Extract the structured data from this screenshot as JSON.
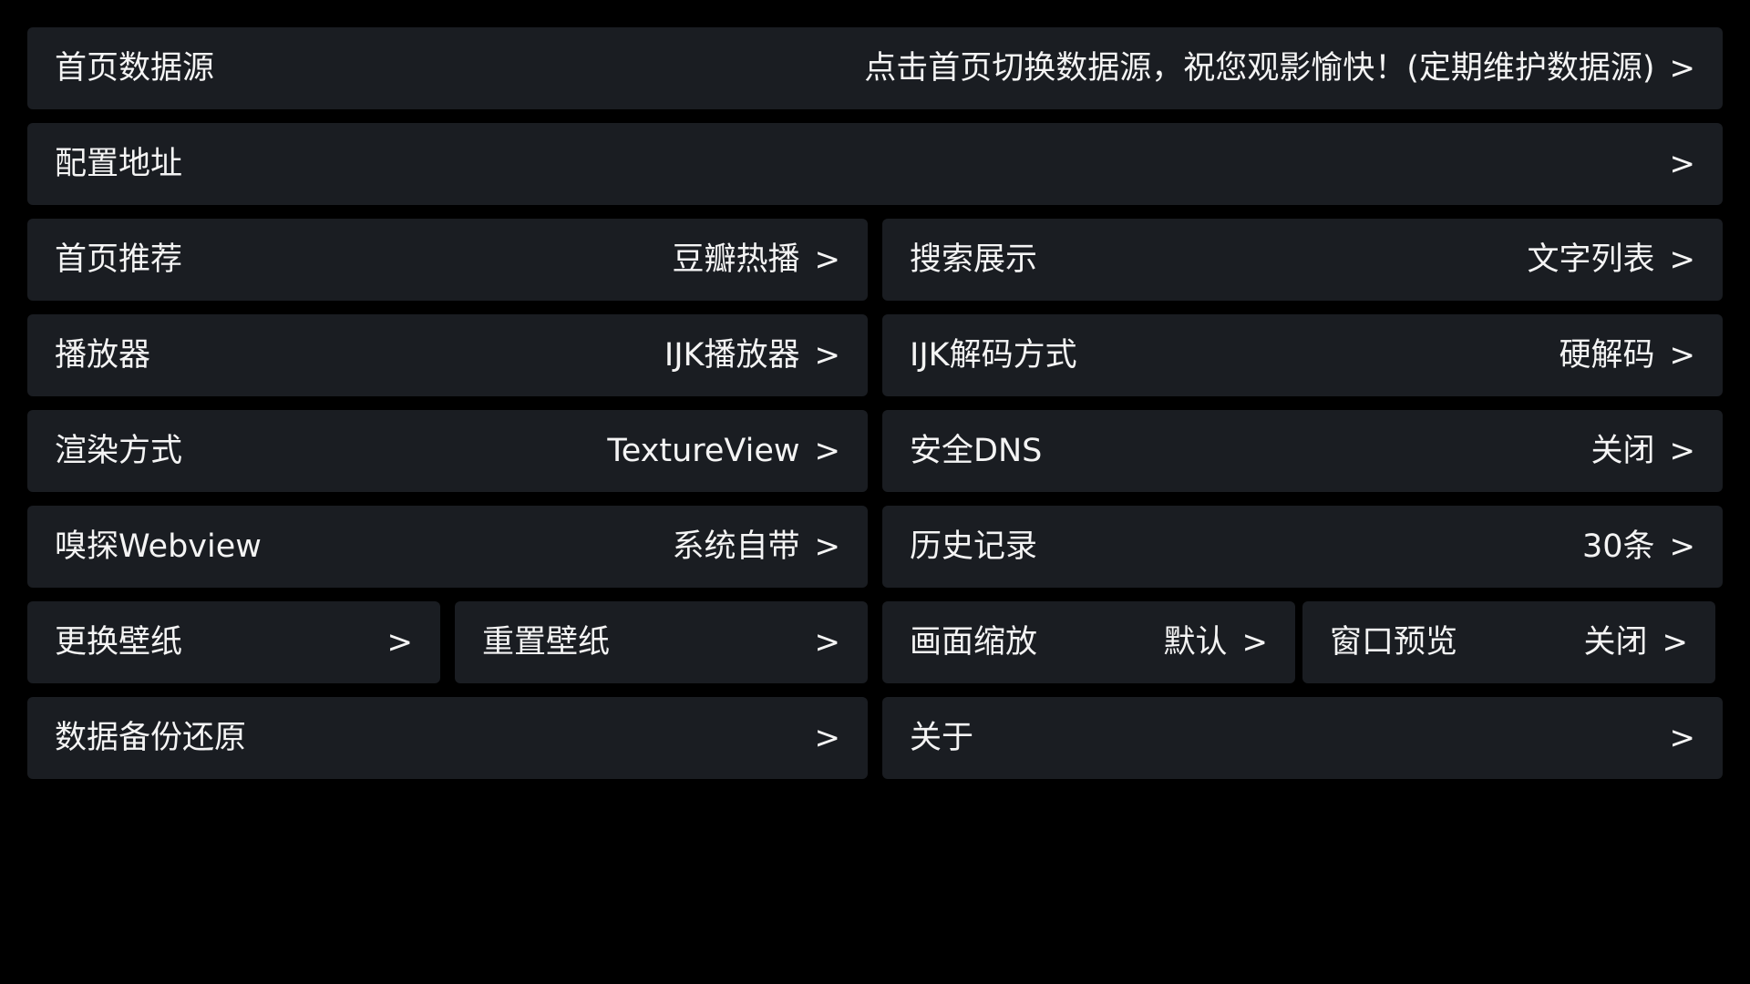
{
  "settings": {
    "home_source": {
      "label": "首页数据源",
      "value": "点击首页切换数据源，祝您观影愉快！(定期维护数据源)",
      "arrow": ">"
    },
    "config_address": {
      "label": "配置地址",
      "arrow": ">"
    },
    "home_recommend": {
      "label": "首页推荐",
      "value": "豆瓣热播",
      "arrow": ">"
    },
    "search_display": {
      "label": "搜索展示",
      "value": "文字列表",
      "arrow": ">"
    },
    "player": {
      "label": "播放器",
      "value": "IJK播放器",
      "arrow": ">"
    },
    "ijk_decode": {
      "label": "IJK解码方式",
      "value": "硬解码",
      "arrow": ">"
    },
    "render_mode": {
      "label": "渲染方式",
      "value": "TextureView",
      "arrow": ">"
    },
    "secure_dns": {
      "label": "安全DNS",
      "value": "关闭",
      "arrow": ">"
    },
    "sniff_webview": {
      "label": "嗅探Webview",
      "value": "系统自带",
      "arrow": ">"
    },
    "history": {
      "label": "历史记录",
      "value": "30条",
      "arrow": ">"
    },
    "change_wallpaper": {
      "label": "更换壁纸",
      "arrow": ">"
    },
    "reset_wallpaper": {
      "label": "重置壁纸",
      "arrow": ">"
    },
    "screen_scale": {
      "label": "画面缩放",
      "value": "默认",
      "arrow": ">"
    },
    "window_preview": {
      "label": "窗口预览",
      "value": "关闭",
      "arrow": ">"
    },
    "backup_restore": {
      "label": "数据备份还原",
      "arrow": ">"
    },
    "about": {
      "label": "关于",
      "arrow": ">"
    }
  },
  "colors": {
    "background": "#000000",
    "tile": "#1a1d22",
    "text": "#f4f4f4"
  },
  "icons": {
    "arrow": "chevron-right-icon",
    "watermark": "watermark-logo-icon"
  }
}
